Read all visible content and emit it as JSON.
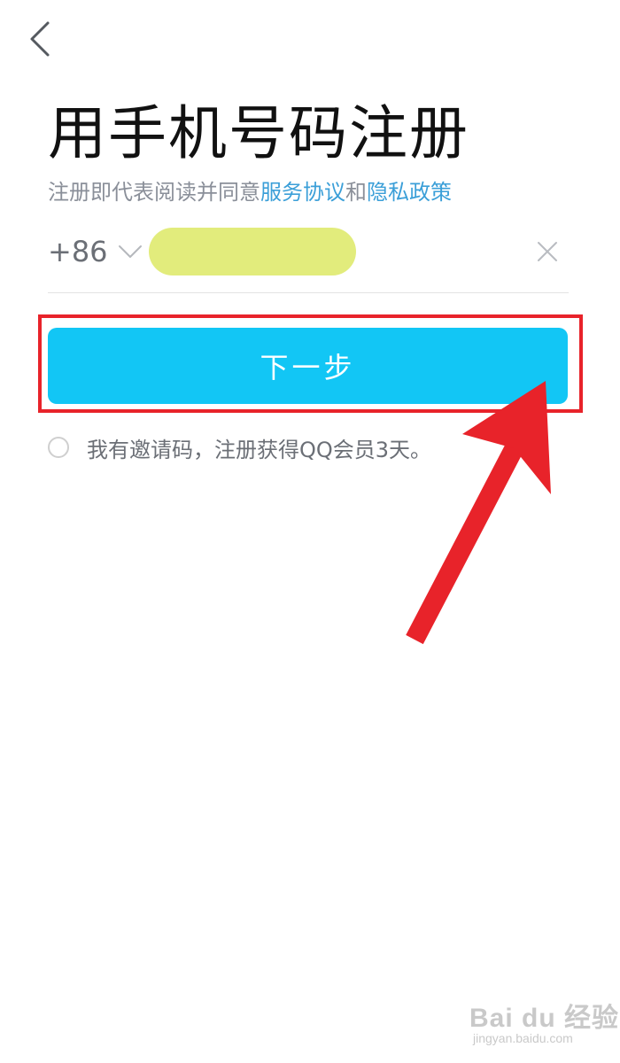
{
  "header": {
    "back_icon": "chevron-left-icon"
  },
  "main": {
    "title": "用手机号码注册",
    "agreement": {
      "prefix": "注册即代表阅读并同意",
      "terms_link": "服务协议",
      "connector": "和",
      "privacy_link": "隐私政策"
    },
    "phone": {
      "country_code": "+86",
      "country_chevron_icon": "chevron-down-icon",
      "input_value": "",
      "clear_icon": "close-icon"
    },
    "next_button_label": "下一步",
    "invite": {
      "checked": false,
      "label": "我有邀请码，注册获得QQ会员3天。"
    }
  },
  "annotation": {
    "highlight_color": "#e8232a",
    "arrow_color": "#e8232a"
  },
  "watermark": {
    "brand": "Bai du 经验",
    "url": "jingyan.baidu.com"
  },
  "colors": {
    "accent": "#12c6f5",
    "link": "#3b9fd8",
    "redacted_fill": "#e2ec7c"
  }
}
